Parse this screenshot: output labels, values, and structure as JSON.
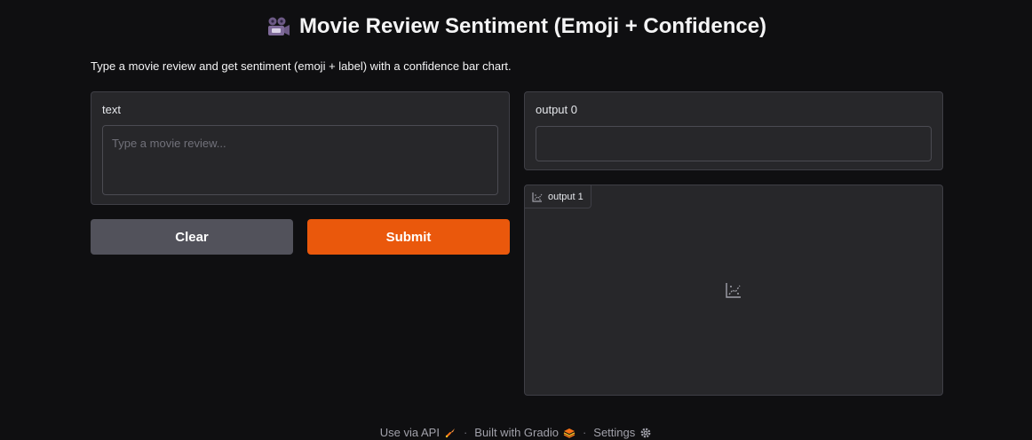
{
  "header": {
    "title": "Movie Review Sentiment (Emoji + Confidence)",
    "icon": "movie-camera-icon",
    "description": "Type a movie review and get sentiment (emoji + label) with a confidence bar chart."
  },
  "input": {
    "label": "text",
    "placeholder": "Type a movie review...",
    "value": ""
  },
  "buttons": {
    "clear_label": "Clear",
    "submit_label": "Submit"
  },
  "outputs": {
    "output0": {
      "label": "output 0",
      "value": ""
    },
    "output1": {
      "label": "output 1",
      "icon": "chart-icon"
    }
  },
  "footer": {
    "api_label": "Use via API",
    "gradio_label": "Built with Gradio",
    "settings_label": "Settings",
    "separator": "·"
  },
  "colors": {
    "background": "#0f0f11",
    "panel": "#27272a",
    "submit": "#ea580c",
    "clear": "#52525b"
  }
}
